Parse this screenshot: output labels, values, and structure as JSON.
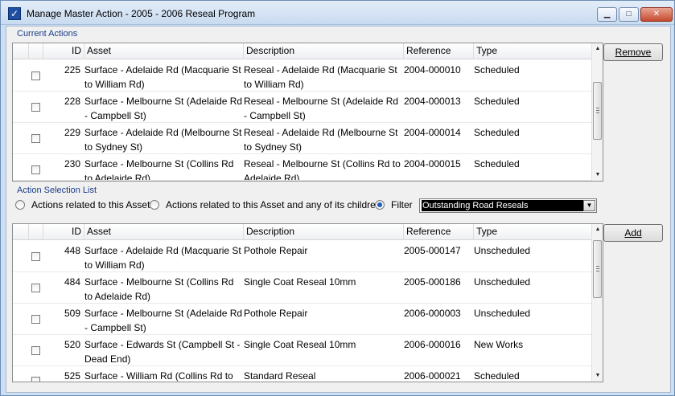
{
  "window": {
    "title": "Manage Master Action - 2005 - 2006 Reseal Program",
    "minimize": "▁",
    "maximize": "□",
    "close": "✕"
  },
  "current_actions": {
    "label": "Current Actions",
    "columns": [
      "ID",
      "Asset",
      "Description",
      "Reference",
      "Type"
    ],
    "rows": [
      {
        "id": "225",
        "asset": "Surface - Adelaide Rd (Macquarie St to William Rd)",
        "description": "Reseal - Adelaide Rd (Macquarie St to William Rd)",
        "reference": "2004-000010",
        "type": "Scheduled"
      },
      {
        "id": "228",
        "asset": "Surface - Melbourne St (Adelaide Rd - Campbell St)",
        "description": "Reseal - Melbourne St (Adelaide Rd - Campbell St)",
        "reference": "2004-000013",
        "type": "Scheduled"
      },
      {
        "id": "229",
        "asset": "Surface - Adelaide Rd (Melbourne St to Sydney St)",
        "description": "Reseal - Adelaide Rd (Melbourne St to Sydney St)",
        "reference": "2004-000014",
        "type": "Scheduled"
      },
      {
        "id": "230",
        "asset": "Surface - Melbourne St (Collins Rd to Adelaide Rd)",
        "description": "Reseal - Melbourne St (Collins Rd to Adelaide Rd)",
        "reference": "2004-000015",
        "type": "Scheduled"
      }
    ],
    "remove_label": "Remove"
  },
  "selection": {
    "label": "Action Selection List",
    "radio_asset": "Actions related to this Asset",
    "radio_children": "Actions related to this Asset and any of its children",
    "radio_filter": "Filter",
    "filter_value": "Outstanding Road Reseals",
    "columns": [
      "ID",
      "Asset",
      "Description",
      "Reference",
      "Type"
    ],
    "rows": [
      {
        "id": "448",
        "asset": "Surface - Adelaide Rd (Macquarie St to William Rd)",
        "description": "Pothole Repair",
        "reference": "2005-000147",
        "type": "Unscheduled"
      },
      {
        "id": "484",
        "asset": "Surface - Melbourne St (Collins Rd to Adelaide Rd)",
        "description": "Single Coat Reseal 10mm",
        "reference": "2005-000186",
        "type": "Unscheduled"
      },
      {
        "id": "509",
        "asset": "Surface - Melbourne St (Adelaide Rd - Campbell St)",
        "description": "Pothole Repair",
        "reference": "2006-000003",
        "type": "Unscheduled"
      },
      {
        "id": "520",
        "asset": "Surface - Edwards St (Campbell St - Dead End)",
        "description": "Single Coat Reseal 10mm",
        "reference": "2006-000016",
        "type": "New Works"
      },
      {
        "id": "525",
        "asset": "Surface - William Rd (Collins Rd to",
        "description": "Standard Reseal",
        "reference": "2006-000021",
        "type": "Scheduled"
      }
    ],
    "add_label": "Add"
  }
}
